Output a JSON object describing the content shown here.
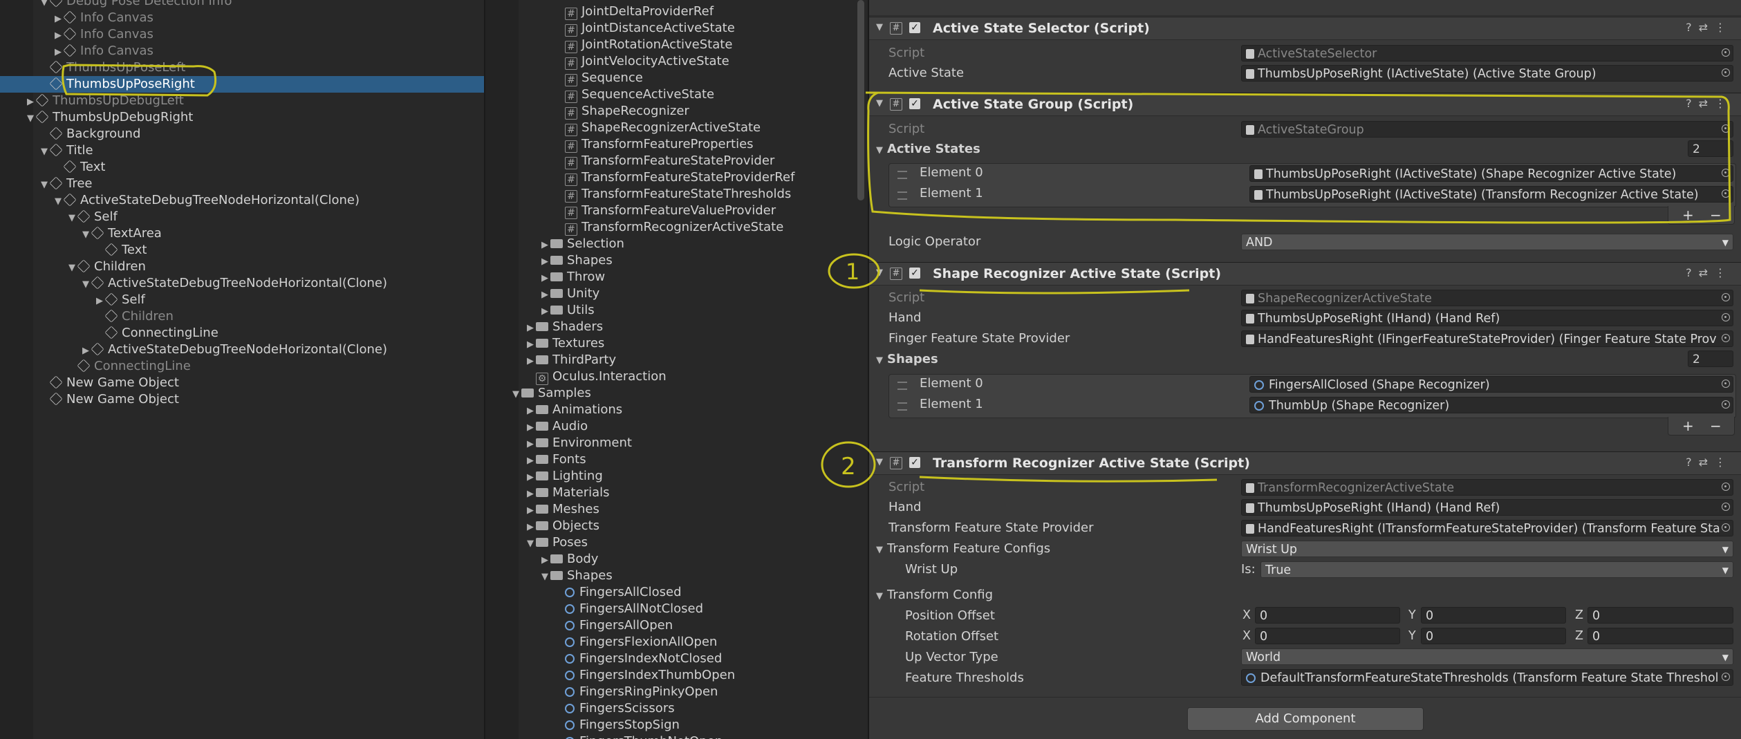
{
  "hierarchy": {
    "items": [
      {
        "label": "Debug Pose Detection Info",
        "dim": true
      },
      {
        "label": "Info Canvas",
        "dim": true
      },
      {
        "label": "Info Canvas",
        "dim": true
      },
      {
        "label": "Info Canvas",
        "dim": true
      },
      {
        "label": "ThumbsUpPoseLeft",
        "dim": true
      },
      {
        "label": "ThumbsUpPoseRight",
        "dim": false,
        "selected": true
      },
      {
        "label": "ThumbsUpDebugLeft",
        "dim": true
      },
      {
        "label": "ThumbsUpDebugRight",
        "dim": false
      },
      {
        "label": "Background",
        "dim": false
      },
      {
        "label": "Title",
        "dim": false
      },
      {
        "label": "Text",
        "dim": false
      },
      {
        "label": "Tree",
        "dim": false
      },
      {
        "label": "ActiveStateDebugTreeNodeHorizontal(Clone)",
        "dim": false
      },
      {
        "label": "Self",
        "dim": false
      },
      {
        "label": "TextArea",
        "dim": false
      },
      {
        "label": "Text",
        "dim": false
      },
      {
        "label": "Children",
        "dim": false
      },
      {
        "label": "ActiveStateDebugTreeNodeHorizontal(Clone)",
        "dim": false
      },
      {
        "label": "Self",
        "dim": false
      },
      {
        "label": "Children",
        "dim": true
      },
      {
        "label": "ConnectingLine",
        "dim": false
      },
      {
        "label": "ActiveStateDebugTreeNodeHorizontal(Clone)",
        "dim": false
      },
      {
        "label": "ConnectingLine",
        "dim": true
      },
      {
        "label": "New Game Object",
        "dim": false
      },
      {
        "label": "New Game Object",
        "dim": false
      }
    ]
  },
  "project": {
    "items": [
      {
        "label": "JointDeltaProviderRef"
      },
      {
        "label": "JointDistanceActiveState"
      },
      {
        "label": "JointRotationActiveState"
      },
      {
        "label": "JointVelocityActiveState"
      },
      {
        "label": "Sequence"
      },
      {
        "label": "SequenceActiveState"
      },
      {
        "label": "ShapeRecognizer"
      },
      {
        "label": "ShapeRecognizerActiveState"
      },
      {
        "label": "TransformFeatureProperties"
      },
      {
        "label": "TransformFeatureStateProvider"
      },
      {
        "label": "TransformFeatureStateProviderRef"
      },
      {
        "label": "TransformFeatureStateThresholds"
      },
      {
        "label": "TransformFeatureValueProvider"
      },
      {
        "label": "TransformRecognizerActiveState"
      },
      {
        "label": "Selection"
      },
      {
        "label": "Shapes"
      },
      {
        "label": "Throw"
      },
      {
        "label": "Unity"
      },
      {
        "label": "Utils"
      },
      {
        "label": "Shaders"
      },
      {
        "label": "Textures"
      },
      {
        "label": "ThirdParty"
      },
      {
        "label": "Oculus.Interaction"
      },
      {
        "label": "Samples"
      },
      {
        "label": "Animations"
      },
      {
        "label": "Audio"
      },
      {
        "label": "Environment"
      },
      {
        "label": "Fonts"
      },
      {
        "label": "Lighting"
      },
      {
        "label": "Materials"
      },
      {
        "label": "Meshes"
      },
      {
        "label": "Objects"
      },
      {
        "label": "Poses"
      },
      {
        "label": "Body"
      },
      {
        "label": "Shapes"
      },
      {
        "label": "FingersAllClosed"
      },
      {
        "label": "FingersAllNotClosed"
      },
      {
        "label": "FingersAllOpen"
      },
      {
        "label": "FingersFlexionAllOpen"
      },
      {
        "label": "FingersIndexNotClosed"
      },
      {
        "label": "FingersIndexThumbOpen"
      },
      {
        "label": "FingersRingPinkyOpen"
      },
      {
        "label": "FingersScissors"
      },
      {
        "label": "FingersStopSign"
      },
      {
        "label": "FingersThumbNotOpen"
      }
    ]
  },
  "inspector": {
    "selector": {
      "title": "Active State Selector (Script)",
      "script_label": "Script",
      "script_value": "ActiveStateSelector",
      "state_label": "Active State",
      "state_value": "ThumbsUpPoseRight (IActiveState) (Active State Group)"
    },
    "group": {
      "title": "Active State Group (Script)",
      "script_label": "Script",
      "script_value": "ActiveStateGroup",
      "states_label": "Active States",
      "states_count": "2",
      "elements": [
        {
          "label": "Element 0",
          "value": "ThumbsUpPoseRight (IActiveState) (Shape Recognizer Active State)"
        },
        {
          "label": "Element 1",
          "value": "ThumbsUpPoseRight (IActiveState) (Transform Recognizer Active State)"
        }
      ],
      "logic_label": "Logic Operator",
      "logic_value": "AND"
    },
    "shape": {
      "title": "Shape Recognizer Active State (Script)",
      "script_label": "Script",
      "script_value": "ShapeRecognizerActiveState",
      "hand_label": "Hand",
      "hand_value": "ThumbsUpPoseRight (IHand) (Hand Ref)",
      "ffsp_label": "Finger Feature State Provider",
      "ffsp_value": "HandFeaturesRight (IFingerFeatureStateProvider) (Finger Feature State Prov",
      "shapes_label": "Shapes",
      "shapes_count": "2",
      "elements": [
        {
          "label": "Element 0",
          "value": "FingersAllClosed (Shape Recognizer)"
        },
        {
          "label": "Element 1",
          "value": "ThumbUp (Shape Recognizer)"
        }
      ]
    },
    "transform": {
      "title": "Transform Recognizer Active State (Script)",
      "script_label": "Script",
      "script_value": "TransformRecognizerActiveState",
      "hand_label": "Hand",
      "hand_value": "ThumbsUpPoseRight (IHand) (Hand Ref)",
      "tfsp_label": "Transform Feature State Provider",
      "tfsp_value": "HandFeaturesRight (ITransformFeatureStateProvider) (Transform Feature Sta",
      "configs_label": "Transform Feature Configs",
      "configs_value": "Wrist Up",
      "wrist_label": "Wrist Up",
      "is_label": "Is:",
      "is_value": "True",
      "tconfig_label": "Transform Config",
      "pos_label": "Position Offset",
      "rot_label": "Rotation Offset",
      "x": "X",
      "y": "Y",
      "z": "Z",
      "pos": {
        "x": "0",
        "y": "0",
        "z": "0"
      },
      "rot": {
        "x": "0",
        "y": "0",
        "z": "0"
      },
      "up_label": "Up Vector Type",
      "up_value": "World",
      "thr_label": "Feature Thresholds",
      "thr_value": "DefaultTransformFeatureStateThresholds (Transform Feature State Threshol"
    },
    "add_component": "Add Component",
    "annotations": {
      "circle1": "1",
      "circle2": "2"
    }
  }
}
